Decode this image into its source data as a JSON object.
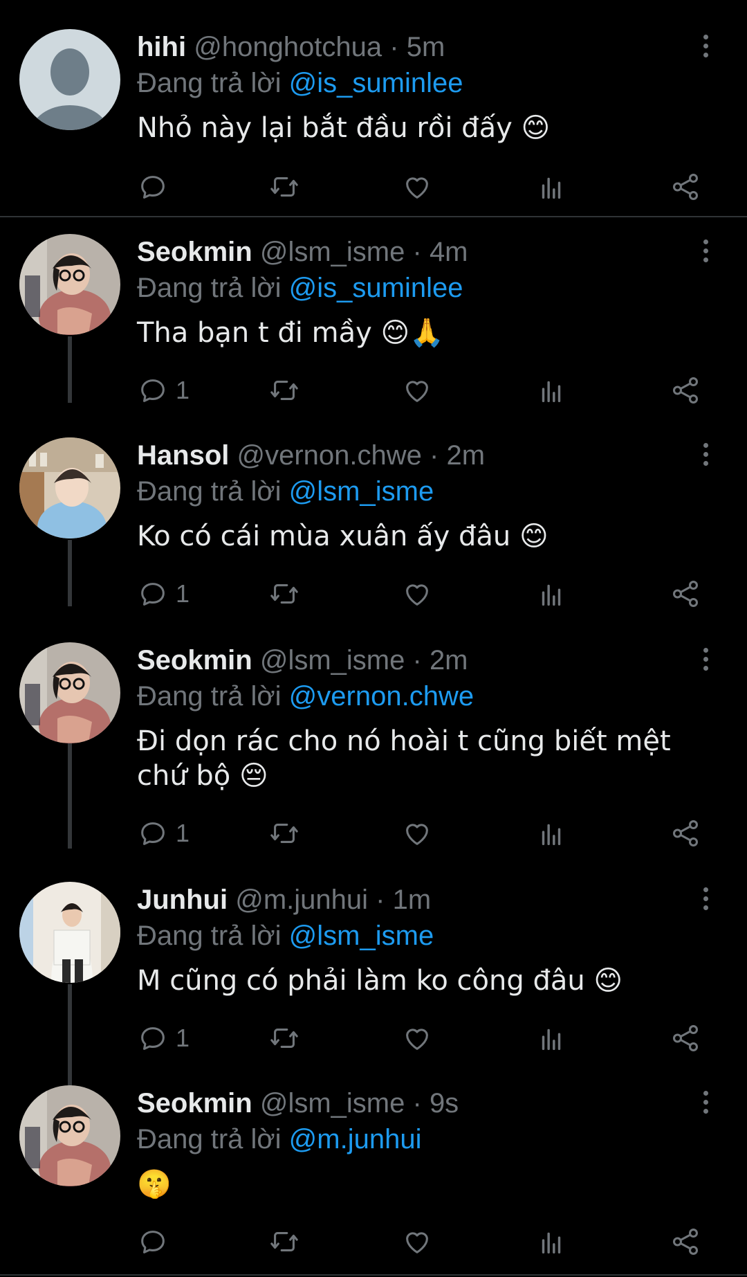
{
  "replying_label": "Đang trả lời",
  "tweets": [
    {
      "name": "hihi",
      "handle": "@honghotchua",
      "sep": "·",
      "time": "5m",
      "reply_to": "@is_suminlee",
      "text": "Nhỏ này lại bắt đầu rồi đấy 😊",
      "reply_count": ""
    },
    {
      "name": "Seokmin",
      "handle": "@lsm_isme",
      "sep": "·",
      "time": "4m",
      "reply_to": "@is_suminlee",
      "text": "Tha bạn t đi mầy 😊🙏",
      "reply_count": "1"
    },
    {
      "name": "Hansol",
      "handle": "@vernon.chwe",
      "sep": "·",
      "time": "2m",
      "reply_to": "@lsm_isme",
      "text": "Ko có cái mùa xuân ấy đâu 😊",
      "reply_count": "1"
    },
    {
      "name": "Seokmin",
      "handle": "@lsm_isme",
      "sep": "·",
      "time": "2m",
      "reply_to": "@vernon.chwe",
      "text": "Đi dọn rác cho nó hoài t cũng biết mệt chứ bộ 😔",
      "reply_count": "1"
    },
    {
      "name": "Junhui",
      "handle": "@m.junhui",
      "sep": "·",
      "time": "1m",
      "reply_to": "@lsm_isme",
      "text": "M cũng có phải làm ko công đâu 😊",
      "reply_count": "1"
    },
    {
      "name": "Seokmin",
      "handle": "@lsm_isme",
      "sep": "·",
      "time": "9s",
      "reply_to": "@m.junhui",
      "text": "🤫",
      "reply_count": ""
    }
  ],
  "icons": {
    "reply": "reply-icon",
    "retweet": "retweet-icon",
    "like": "heart-icon",
    "views": "views-icon",
    "share": "share-icon",
    "more": "more-options-icon"
  },
  "colors": {
    "background": "#000000",
    "text": "#e7e9ea",
    "muted": "#71767b",
    "mention": "#1d9bf0",
    "divider": "#2f3336"
  }
}
